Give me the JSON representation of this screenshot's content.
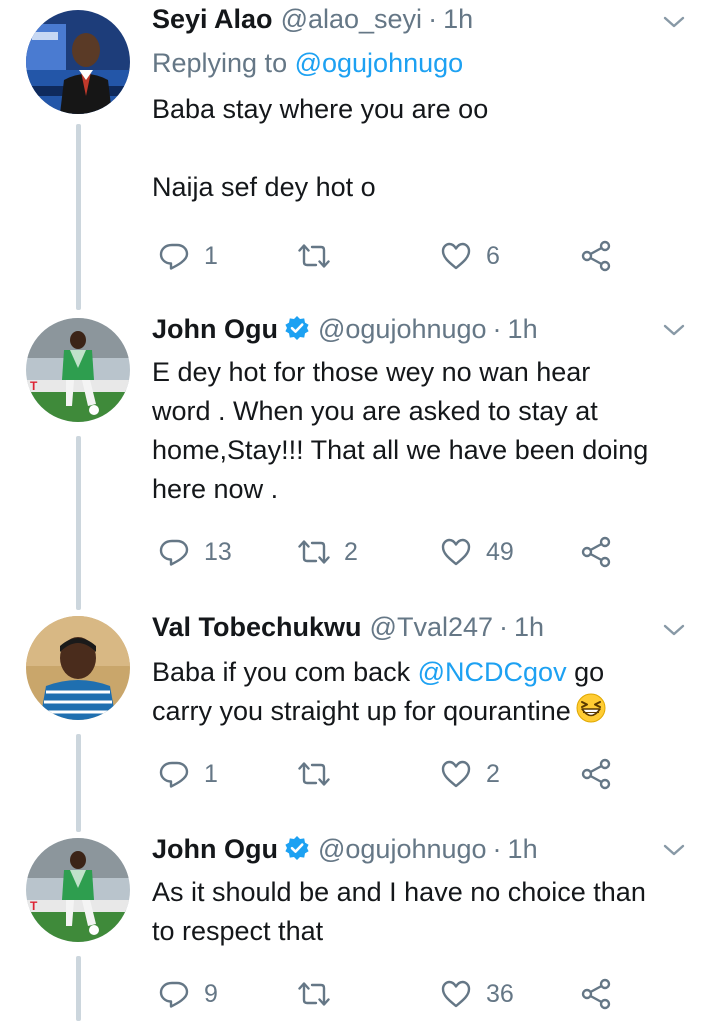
{
  "colors": {
    "accent": "#1da1f2",
    "secondary_text": "#657786",
    "primary_text": "#14171a",
    "thread_line": "#ccd6dd",
    "verified": "#1da1f2"
  },
  "tweets": [
    {
      "name": "Seyi Alao",
      "handle": "@alao_seyi",
      "dot": "·",
      "time": "1h",
      "verified": false,
      "replying_prefix": "Replying to ",
      "replying_handle": "@ogujohnugo",
      "lines": [
        "Baba stay where you are oo",
        "Naija sef dey hot o"
      ],
      "replies": "1",
      "retweets": "",
      "likes": "6"
    },
    {
      "name": "John Ogu",
      "handle": "@ogujohnugo",
      "dot": "·",
      "time": "1h",
      "verified": true,
      "lines": [
        "E dey hot for those wey no wan hear",
        "word . When you are asked to stay at",
        "home,Stay!!! That all we have been doing",
        "here now ."
      ],
      "replies": "13",
      "retweets": "2",
      "likes": "49"
    },
    {
      "name": "Val Tobechukwu",
      "handle": "@Tval247",
      "dot": "·",
      "time": "1h",
      "verified": false,
      "line1_prefix": "Baba if you com back ",
      "line1_mention": "@NCDCgov",
      "line1_suffix": " go",
      "line2": "carry you straight up for qourantine",
      "emoji_icon": "grinning-squinting-face-icon",
      "replies": "1",
      "retweets": "",
      "likes": "2"
    },
    {
      "name": "John Ogu",
      "handle": "@ogujohnugo",
      "dot": "·",
      "time": "1h",
      "verified": true,
      "lines": [
        "As it should be and I have no choice than",
        "to respect that"
      ],
      "replies": "9",
      "retweets": "",
      "likes": "36"
    }
  ]
}
